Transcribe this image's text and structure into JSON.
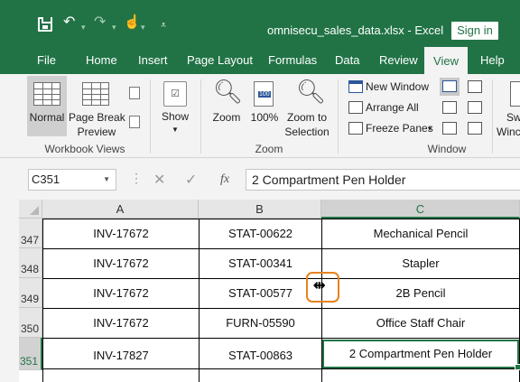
{
  "titlebar": {
    "filename": "omnisecu_sales_data.xlsx",
    "app": "Excel",
    "separator": "-",
    "signin_label": "Sign in",
    "icons": [
      "save-icon",
      "undo-icon",
      "redo-icon",
      "touch-mode-icon",
      "customize-quick-access-icon"
    ]
  },
  "tabs": [
    "File",
    "Home",
    "Insert",
    "Page Layout",
    "Formulas",
    "Data",
    "Review",
    "View",
    "Help"
  ],
  "active_tab": "View",
  "ribbon": {
    "workbook_views": {
      "label": "Workbook Views",
      "normal": "Normal",
      "page_break_1": "Page Break",
      "page_break_2": "Preview"
    },
    "show": {
      "label": "Show"
    },
    "zoom": {
      "label": "Zoom",
      "zoom_btn": "Zoom",
      "pct_btn": "100%",
      "pct_icon_text": "100",
      "sel_1": "Zoom to",
      "sel_2": "Selection"
    },
    "window": {
      "label": "Window",
      "new_window": "New Window",
      "arrange_all": "Arrange All",
      "freeze_panes": "Freeze Panes",
      "switch_partial": "Sw",
      "windows_partial": "Winc"
    }
  },
  "formula_bar": {
    "name_box": "C351",
    "fx_label": "fx",
    "content": "2 Compartment Pen Holder"
  },
  "grid": {
    "columns": [
      "A",
      "B",
      "C"
    ],
    "selected_column": "C",
    "rows": [
      {
        "num": "347",
        "a": "INV-17672",
        "b": "STAT-00622",
        "c": "Mechanical Pencil"
      },
      {
        "num": "348",
        "a": "INV-17672",
        "b": "STAT-00341",
        "c": "Stapler"
      },
      {
        "num": "349",
        "a": "INV-17672",
        "b": "STAT-00577",
        "c": "2B Pencil"
      },
      {
        "num": "350",
        "a": "INV-17672",
        "b": "FURN-05590",
        "c": "Office Staff Chair"
      },
      {
        "num": "351",
        "a": "INV-17827",
        "b": "STAT-00863",
        "c": "2 Compartment Pen Holder"
      }
    ],
    "selected_row": "351"
  },
  "colors": {
    "accent": "#217346",
    "highlight": "#e8821e"
  }
}
